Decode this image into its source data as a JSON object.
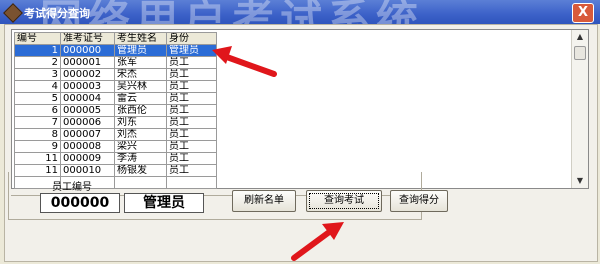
{
  "window": {
    "title": "考试得分查询",
    "watermark": "网络用户考试系统",
    "close_label": "X"
  },
  "table": {
    "headers": [
      "编号",
      "准考证号",
      "考生姓名",
      "身份"
    ],
    "rows": [
      [
        "1",
        "000000",
        "管理员",
        "管理员"
      ],
      [
        "2",
        "000001",
        "张军",
        "员工"
      ],
      [
        "3",
        "000002",
        "宋杰",
        "员工"
      ],
      [
        "4",
        "000003",
        "吴兴林",
        "员工"
      ],
      [
        "5",
        "000004",
        "雷云",
        "员工"
      ],
      [
        "6",
        "000005",
        "张西伦",
        "员工"
      ],
      [
        "7",
        "000006",
        "刘东",
        "员工"
      ],
      [
        "8",
        "000007",
        "刘杰",
        "员工"
      ],
      [
        "9",
        "000008",
        "梁兴",
        "员工"
      ],
      [
        "11",
        "000009",
        "李涛",
        "员工"
      ],
      [
        "11",
        "000010",
        "杨银发",
        "员工"
      ],
      [
        "",
        "",
        "",
        ""
      ]
    ],
    "selected_row": 0
  },
  "employee": {
    "label": "员工编号",
    "id_value": "000000",
    "name_value": "管理员"
  },
  "buttons": {
    "refresh": "刷新名单",
    "query_exam": "查询考试",
    "query_score": "查询得分"
  },
  "colors": {
    "selection": "#2b6cd6",
    "annotation_arrow": "#e0161b"
  },
  "icons": {
    "app": "app-icon",
    "close": "close-icon",
    "scroll_up": "scroll-up-arrow-icon",
    "scroll_down": "scroll-down-arrow-icon"
  }
}
